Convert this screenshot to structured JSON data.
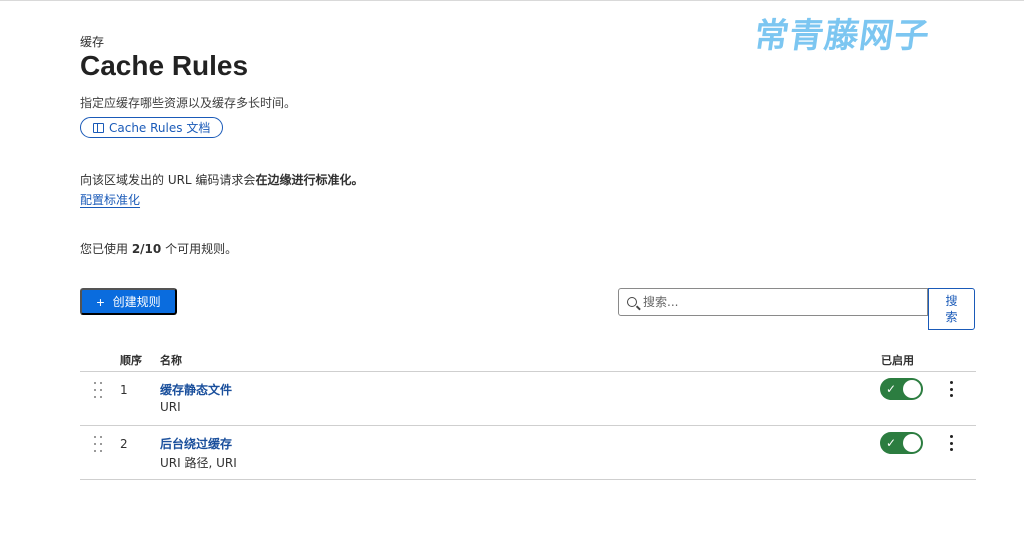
{
  "watermark": "常青藤网子",
  "header": {
    "breadcrumb": "缓存",
    "title": "Cache Rules",
    "description": "指定应缓存哪些资源以及缓存多长时间。",
    "doc_link_label": "Cache Rules 文档"
  },
  "normalization": {
    "text_prefix": "向该区域发出的 URL 编码请求会",
    "text_bold": "在边缘进行标准化。",
    "link_label": "配置标准化"
  },
  "usage": {
    "prefix": "您已使用 ",
    "count": "2/10",
    "suffix": " 个可用规则。"
  },
  "toolbar": {
    "create_label": "创建规则",
    "search_placeholder": "搜索...",
    "search_button": "搜 索"
  },
  "table": {
    "headers": {
      "order": "顺序",
      "name": "名称",
      "enabled": "已启用"
    },
    "rows": [
      {
        "order": "1",
        "name": "缓存静态文件",
        "sub": "URI",
        "enabled": true
      },
      {
        "order": "2",
        "name": "后台绕过缓存",
        "sub": "URI 路径, URI",
        "enabled": true
      }
    ]
  },
  "colors": {
    "primary": "#0a6cde",
    "link": "#1a5ab8",
    "toggle_on": "#2c7d40"
  }
}
